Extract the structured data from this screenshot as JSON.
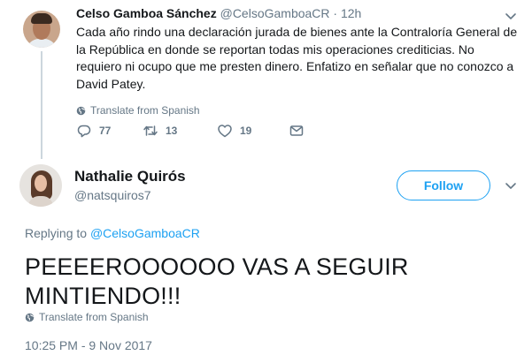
{
  "tweet1": {
    "name": "Celso Gamboa Sánchez",
    "handle": "@CelsoGamboaCR",
    "separator": "·",
    "time": "12h",
    "text": "Cada año rindo una declaración jurada de bienes ante la Contraloría General de la República en donde se reportan todas mis operaciones crediticias. No requiero ni ocupo que me presten dinero. Enfatizo en señalar que no conozco a David Patey.",
    "translate_label": "Translate from Spanish",
    "reply_count": "77",
    "retweet_count": "13",
    "like_count": "19",
    "icons": [
      "reply-icon",
      "retweet-icon",
      "like-icon",
      "direct-message-icon",
      "globe-icon",
      "chevron-down-icon"
    ]
  },
  "tweet2": {
    "name": "Nathalie Quirós",
    "handle": "@natsquiros7",
    "follow_label": "Follow",
    "replying_prefix": "Replying to",
    "replying_to": "@CelsoGamboaCR",
    "text": "PEEEEROOOOOO VAS A SEGUIR MINTIENDO!!!",
    "translate_label": "Translate from Spanish",
    "timestamp": "10:25 PM - 9 Nov 2017"
  },
  "colors": {
    "accent": "#1da1f2",
    "secondary_text": "#657786",
    "primary_text": "#14171a",
    "thread_line": "#ccd6dd"
  }
}
